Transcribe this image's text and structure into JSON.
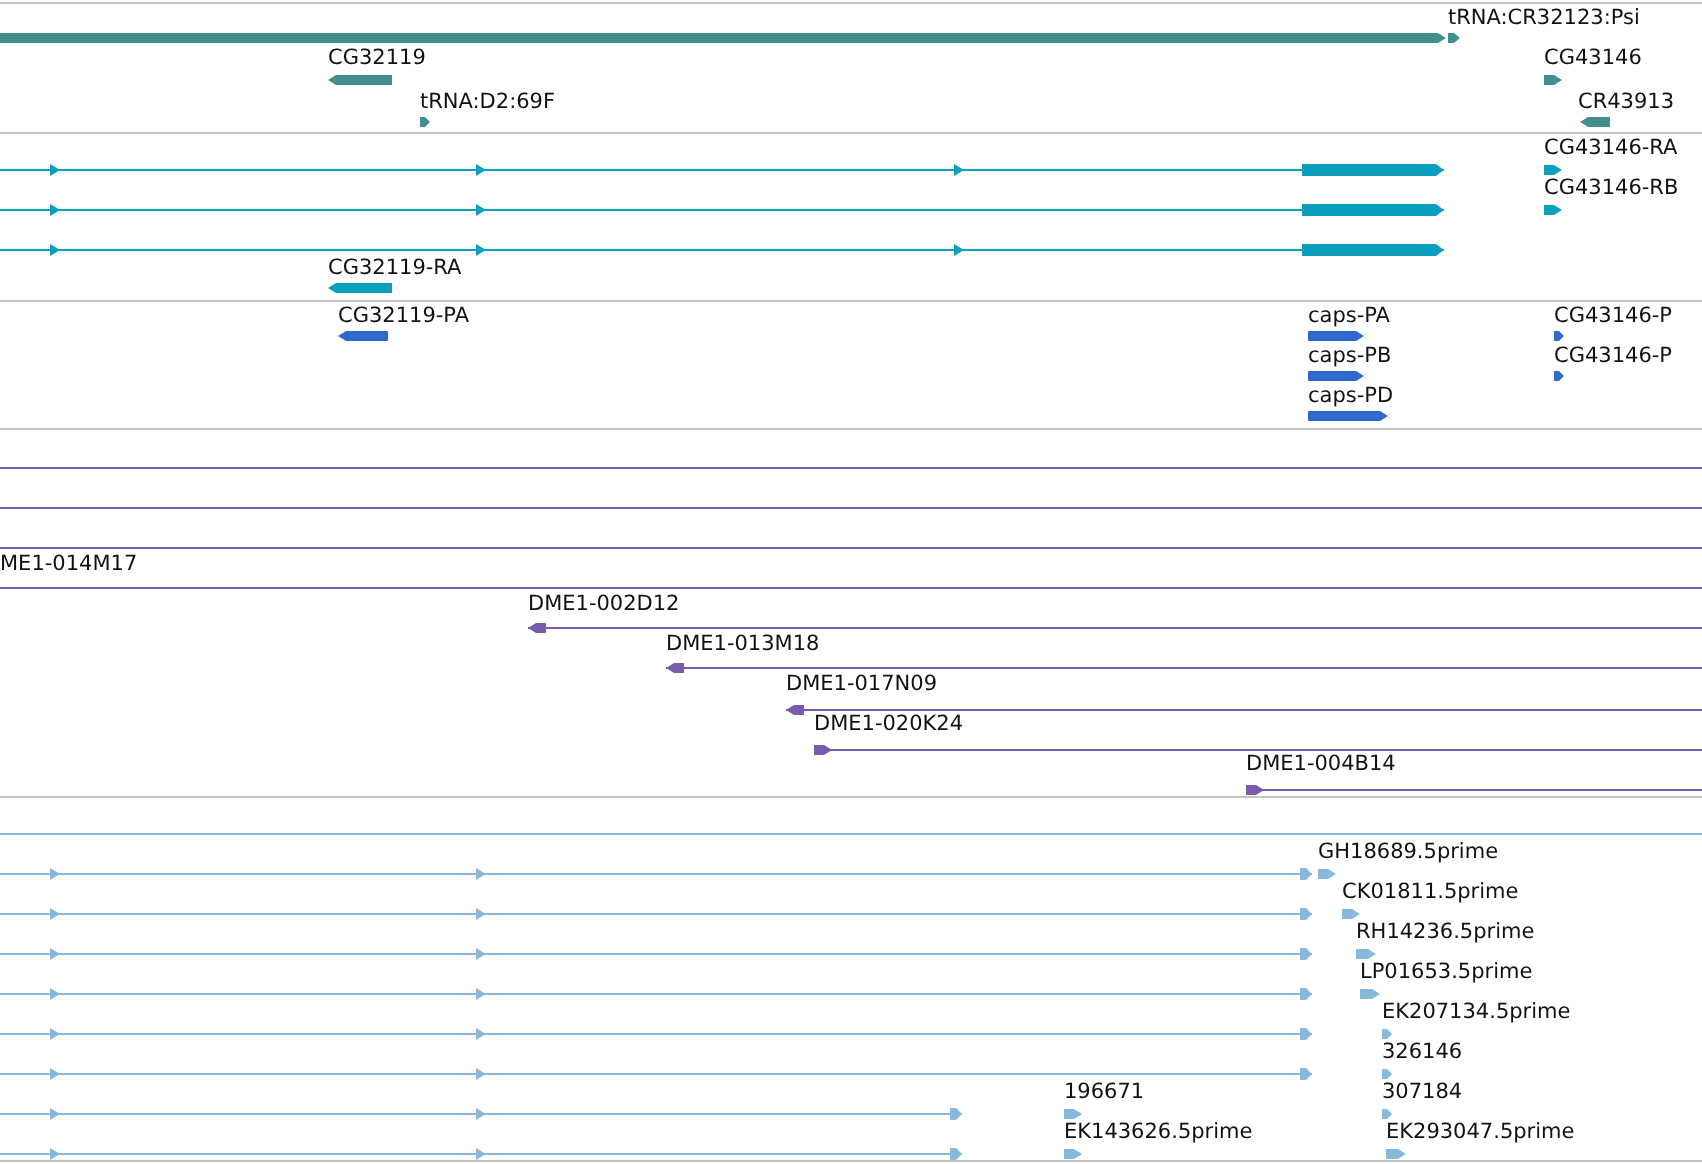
{
  "tracks": [
    {
      "kind": "gene",
      "features": [
        {
          "kind": "feature",
          "reverse": false
        },
        {
          "kind": "feature",
          "label": "tRNA:CR32123:Psi",
          "reverse": false
        },
        {
          "kind": "feature",
          "label": "CG32119",
          "reverse": true
        },
        {
          "kind": "feature",
          "label": "tRNA:D2:69F",
          "reverse": false
        },
        {
          "kind": "feature",
          "label": "CG43146",
          "reverse": false
        },
        {
          "kind": "feature",
          "label": "CR43913",
          "reverse": true
        }
      ]
    },
    {
      "kind": "transcript",
      "features": [
        {
          "kind": "feature",
          "reverse": false
        },
        {
          "kind": "feature",
          "reverse": false
        },
        {
          "kind": "feature",
          "reverse": false
        },
        {
          "kind": "feature",
          "label": "CG32119-RA",
          "reverse": true
        },
        {
          "kind": "feature",
          "label": "CG43146-RA",
          "reverse": false
        },
        {
          "kind": "feature",
          "label": "CG43146-RB",
          "reverse": false
        }
      ]
    },
    {
      "kind": "protein",
      "features": [
        {
          "kind": "feature",
          "label": "CG32119-PA",
          "reverse": true
        },
        {
          "kind": "feature",
          "label": "caps-PA",
          "reverse": false
        },
        {
          "kind": "feature",
          "label": "caps-PB",
          "reverse": false
        },
        {
          "kind": "feature",
          "label": "caps-PD",
          "reverse": false
        },
        {
          "kind": "feature",
          "label": "CG43146-P",
          "reverse": false
        },
        {
          "kind": "feature",
          "label": "CG43146-P",
          "reverse": false
        }
      ]
    },
    {
      "kind": "clone",
      "features": [
        {
          "kind": "line"
        },
        {
          "kind": "line"
        },
        {
          "kind": "line"
        },
        {
          "kind": "line",
          "label": "ME1-014M17"
        },
        {
          "kind": "feature",
          "label": "DME1-002D12",
          "reverse": true
        },
        {
          "kind": "feature",
          "label": "DME1-013M18",
          "reverse": true
        },
        {
          "kind": "feature",
          "label": "DME1-017N09",
          "reverse": true
        },
        {
          "kind": "feature",
          "label": "DME1-020K24",
          "reverse": false
        },
        {
          "kind": "feature",
          "label": "DME1-004B14",
          "reverse": false
        }
      ]
    },
    {
      "kind": "est",
      "features": [
        {
          "kind": "line"
        },
        {
          "kind": "feature",
          "reverse": false
        },
        {
          "kind": "feature",
          "reverse": false
        },
        {
          "kind": "feature",
          "reverse": false
        },
        {
          "kind": "feature",
          "reverse": false
        },
        {
          "kind": "feature",
          "reverse": false
        },
        {
          "kind": "feature",
          "reverse": false
        },
        {
          "kind": "feature",
          "reverse": false
        },
        {
          "kind": "feature",
          "reverse": false
        },
        {
          "kind": "feature",
          "label": "GH18689.5prime",
          "reverse": false
        },
        {
          "kind": "feature",
          "label": "CK01811.5prime",
          "reverse": false
        },
        {
          "kind": "feature",
          "label": "RH14236.5prime",
          "reverse": false
        },
        {
          "kind": "feature",
          "label": "LP01653.5prime",
          "reverse": false
        },
        {
          "kind": "feature",
          "label": "EK207134.5prime",
          "reverse": false
        },
        {
          "kind": "feature",
          "label": "326146",
          "reverse": false
        },
        {
          "kind": "feature",
          "label": "307184",
          "reverse": false
        },
        {
          "kind": "feature",
          "label": "EK293047.5prime",
          "reverse": false
        },
        {
          "kind": "feature",
          "label": "196671",
          "reverse": false
        },
        {
          "kind": "feature",
          "label": "EK143626.5prime",
          "reverse": false
        }
      ]
    }
  ]
}
